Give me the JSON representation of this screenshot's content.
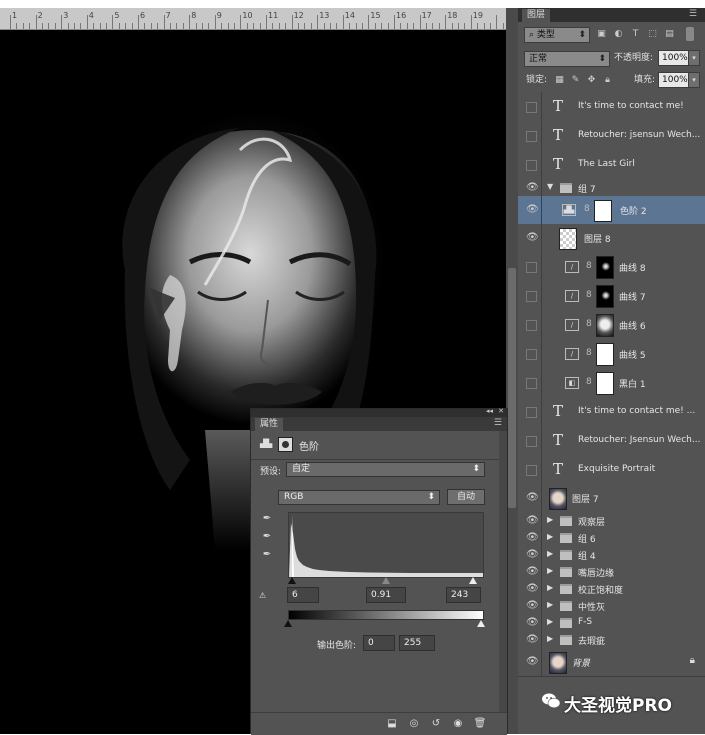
{
  "ruler": {
    "numbers": [
      "1",
      "2",
      "3",
      "4",
      "5",
      "6",
      "7",
      "8",
      "9",
      "10",
      "11",
      "12",
      "13",
      "14",
      "15",
      "16",
      "17",
      "18",
      "19"
    ]
  },
  "layers_panel": {
    "tab": "图层",
    "filter_kind": "类型",
    "blend_mode": "正常",
    "opacity_label": "不透明度:",
    "opacity_value": "100%",
    "lock_label": "锁定:",
    "fill_label": "填充:",
    "fill_value": "100%",
    "layers": [
      {
        "name": "It's time to contact me!",
        "type": "text",
        "visible": false
      },
      {
        "name": "Retoucher: jsensun Wech...",
        "type": "text",
        "visible": false
      },
      {
        "name": "The Last Girl",
        "type": "text",
        "visible": false
      },
      {
        "name": "组 7",
        "type": "group-open",
        "visible": true
      },
      {
        "name": "色阶 2",
        "type": "adjustment-levels",
        "visible": true,
        "selected": true
      },
      {
        "name": "图层 8",
        "type": "pixel-empty",
        "visible": true
      },
      {
        "name": "曲线 8",
        "type": "curves",
        "visible": false
      },
      {
        "name": "曲线 7",
        "type": "curves",
        "visible": false
      },
      {
        "name": "曲线 6",
        "type": "curves",
        "visible": false
      },
      {
        "name": "曲线 5",
        "type": "curves",
        "visible": false
      },
      {
        "name": "黑白 1",
        "type": "blackwhite",
        "visible": false
      },
      {
        "name": "It's time to contact me! ...",
        "type": "text",
        "visible": false
      },
      {
        "name": "Retoucher: Jsensun Wech...",
        "type": "text",
        "visible": false
      },
      {
        "name": "Exquisite Portrait",
        "type": "text",
        "visible": false
      },
      {
        "name": "图层 7",
        "type": "pixel-face",
        "visible": true
      },
      {
        "name": "观察层",
        "type": "group",
        "visible": true
      },
      {
        "name": "组 6",
        "type": "group",
        "visible": true
      },
      {
        "name": "组 4",
        "type": "group",
        "visible": true
      },
      {
        "name": "嘴唇边缘",
        "type": "group",
        "visible": true
      },
      {
        "name": "校正饱和度",
        "type": "group",
        "visible": true
      },
      {
        "name": "中性灰",
        "type": "group",
        "visible": true
      },
      {
        "name": "F-S",
        "type": "group",
        "visible": true
      },
      {
        "name": "去瑕疵",
        "type": "group",
        "visible": true
      },
      {
        "name": "背景",
        "type": "background",
        "visible": true
      }
    ]
  },
  "properties_panel": {
    "tab": "属性",
    "title": "色阶",
    "preset_label": "预设:",
    "preset_value": "自定",
    "channel": "RGB",
    "auto_button": "自动",
    "input_black": "6",
    "input_gamma": "0.91",
    "input_white": "243",
    "output_label": "输出色阶:",
    "output_black": "0",
    "output_white": "255"
  },
  "watermark": {
    "text": "大圣视觉PRO"
  }
}
